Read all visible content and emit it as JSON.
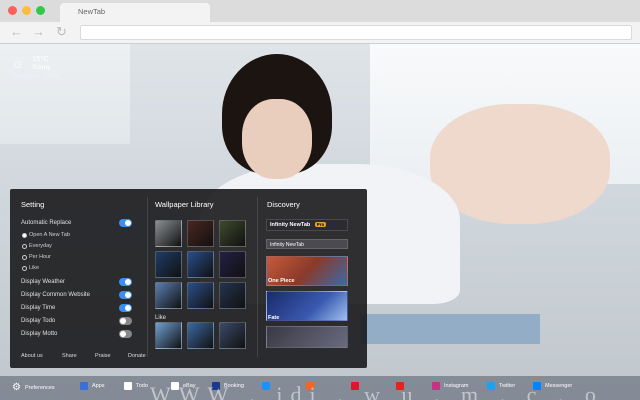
{
  "browser": {
    "tab_title": "NewTab",
    "traffic_colors": [
      "#fc605b",
      "#fdbc40",
      "#34c84a"
    ],
    "back_icon": "arrow-left-icon",
    "forward_icon": "arrow-right-icon",
    "reload_icon": "reload-icon"
  },
  "weather": {
    "icon": "sun-icon",
    "temperature": "15°C",
    "condition": "Sunny",
    "location": "Chongqing , China"
  },
  "panel": {
    "setting": {
      "title": "Setting",
      "auto_replace_label": "Automatic Replace",
      "auto_replace_on": true,
      "radio_options": [
        {
          "label": "Open A New Tab",
          "selected": true
        },
        {
          "label": "Everyday",
          "selected": false
        },
        {
          "label": "Per Hour",
          "selected": false
        },
        {
          "label": "Like",
          "selected": false
        }
      ],
      "toggles": [
        {
          "label": "Display Weather",
          "on": true
        },
        {
          "label": "Display Common Website",
          "on": true
        },
        {
          "label": "Display Time",
          "on": true
        },
        {
          "label": "Display Todo",
          "on": false
        },
        {
          "label": "Display Motto",
          "on": false
        }
      ],
      "footer_links": [
        "About us",
        "Share",
        "Praise",
        "Donate"
      ]
    },
    "library": {
      "title": "Wallpaper Library",
      "like_label": "Like",
      "thumb_colors": [
        "#8a8f93",
        "#4a2620",
        "#3e4a2e",
        "#1f3c66",
        "#2a4d8a",
        "#232044",
        "#5a7fb0",
        "#2b4f88",
        "#24344f",
        "#6f9fd0",
        "#3b69a0",
        "#3a4a68"
      ]
    },
    "discovery": {
      "title": "Discovery",
      "header": "Infinity NewTab",
      "header_badge": "Pro",
      "sub_header": "Infinity NewTab",
      "cards": [
        {
          "label": "One Piece",
          "color": "#8a3a2a"
        },
        {
          "label": "Fate",
          "color": "#2a3f86"
        },
        {
          "label": "",
          "color": "#3a3a44"
        }
      ]
    }
  },
  "dock": {
    "preferences_label": "Preferences",
    "preferences_icon": "gear-icon",
    "items": [
      {
        "label": "Apps",
        "icon": "apps-icon",
        "color": "#3a6fd8"
      },
      {
        "label": "Todo",
        "icon": "todo-icon",
        "color": "#ffffff"
      },
      {
        "label": "eBay",
        "icon": "ebay-icon",
        "color": "#ffffff"
      },
      {
        "label": "Booking",
        "icon": "booking-icon",
        "color": "#1a3b8c"
      },
      {
        "label": "",
        "icon": "site-icon-blue",
        "color": "#1e90ff"
      },
      {
        "label": "",
        "icon": "site-icon-orange",
        "color": "#f26522"
      },
      {
        "label": "",
        "icon": "site-icon-red",
        "color": "#e8112d"
      },
      {
        "label": "",
        "icon": "site-icon-jd",
        "color": "#e1251b"
      },
      {
        "label": "Instagram",
        "icon": "instagram-icon",
        "color": "#c13584"
      },
      {
        "label": "Twitter",
        "icon": "twitter-icon",
        "color": "#1da1f2"
      },
      {
        "label": "Messenger",
        "icon": "messenger-icon",
        "color": "#0084ff"
      }
    ]
  }
}
